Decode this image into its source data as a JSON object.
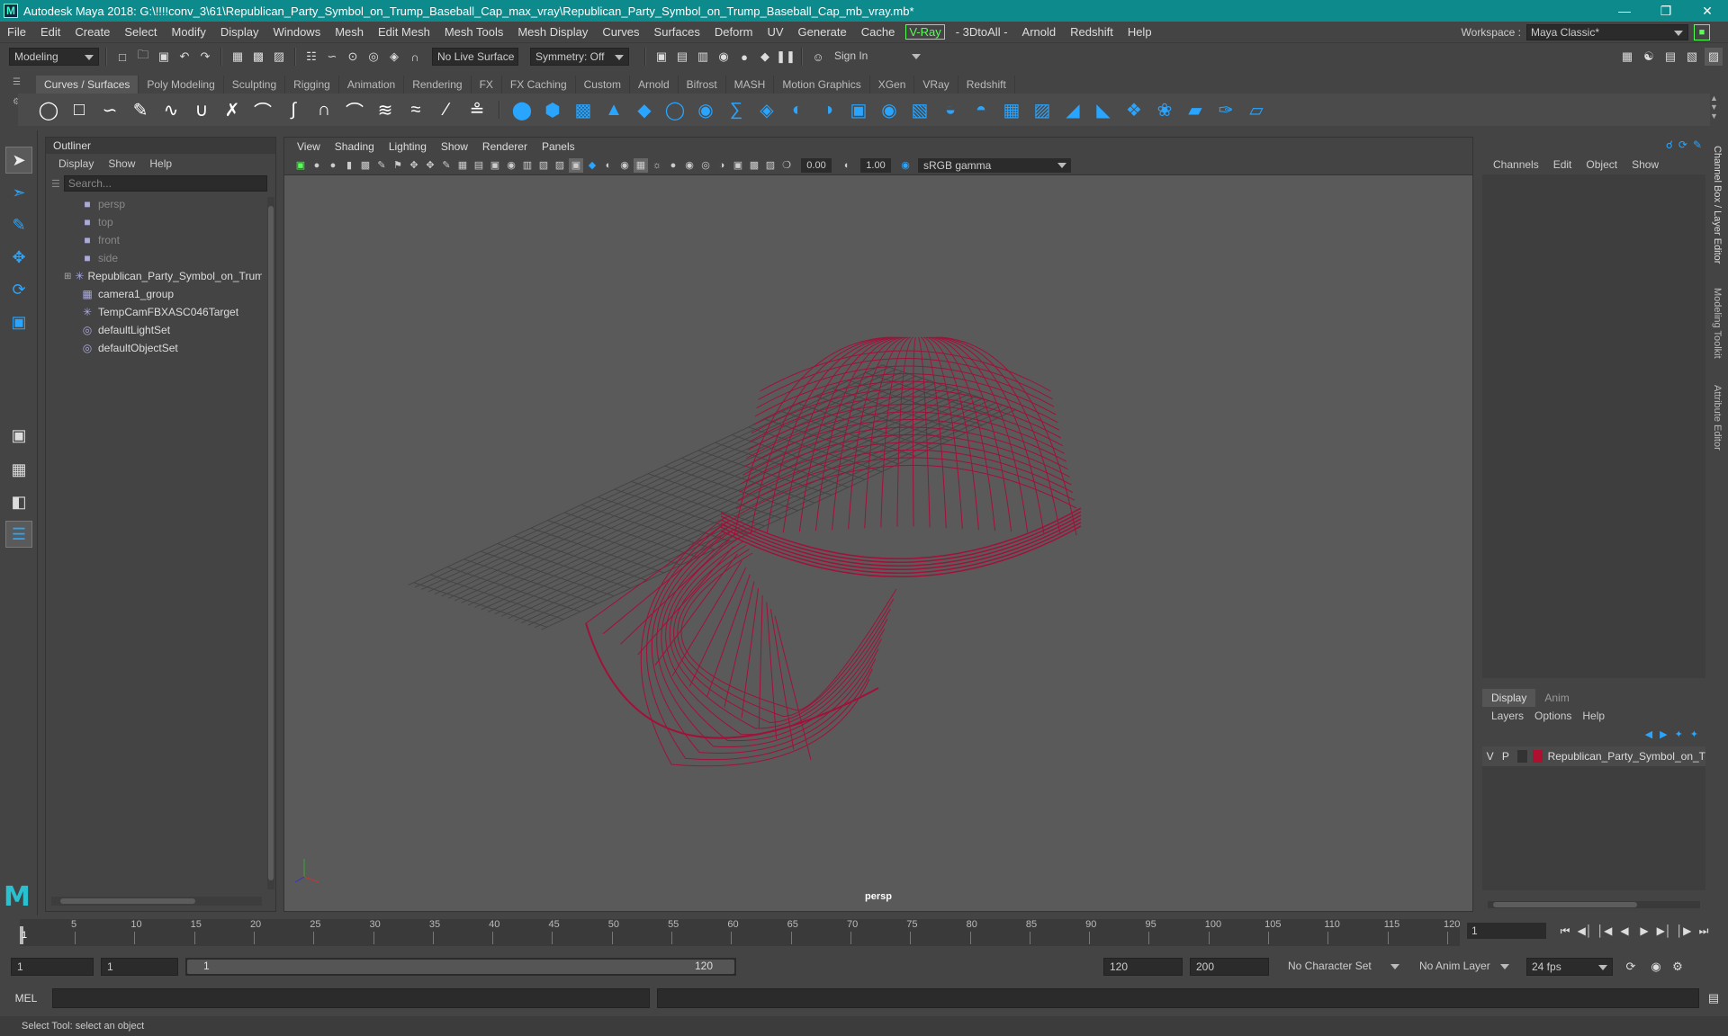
{
  "window": {
    "title": "Autodesk Maya 2018: G:\\!!!!conv_3\\61\\Republican_Party_Symbol_on_Trump_Baseball_Cap_max_vray\\Republican_Party_Symbol_on_Trump_Baseball_Cap_mb_vray.mb*",
    "logo": "M"
  },
  "menubar": {
    "items": [
      "File",
      "Edit",
      "Create",
      "Select",
      "Modify",
      "Display",
      "Windows",
      "Mesh",
      "Edit Mesh",
      "Mesh Tools",
      "Mesh Display",
      "Curves",
      "Surfaces",
      "Deform",
      "UV",
      "Generate",
      "Cache",
      "V-Ray",
      "- 3DtoAll -",
      "Arnold",
      "Redshift",
      "Help"
    ],
    "workspace_label": "Workspace :",
    "workspace_value": "Maya Classic*"
  },
  "statusline": {
    "mode": "Modeling",
    "live_surface": "No Live Surface",
    "symmetry": "Symmetry: Off",
    "sign_in": "Sign In"
  },
  "shelf": {
    "tabs": [
      "Curves / Surfaces",
      "Poly Modeling",
      "Sculpting",
      "Rigging",
      "Animation",
      "Rendering",
      "FX",
      "FX Caching",
      "Custom",
      "Arnold",
      "Bifrost",
      "MASH",
      "Motion Graphics",
      "XGen",
      "VRay",
      "Redshift"
    ],
    "active_tab": "Curves / Surfaces"
  },
  "outliner": {
    "title": "Outliner",
    "menu": [
      "Display",
      "Show",
      "Help"
    ],
    "search_placeholder": "Search...",
    "items": [
      {
        "label": "persp",
        "icon": "camera-icon",
        "dim": true,
        "expandable": false
      },
      {
        "label": "top",
        "icon": "camera-icon",
        "dim": true,
        "expandable": false
      },
      {
        "label": "front",
        "icon": "camera-icon",
        "dim": true,
        "expandable": false
      },
      {
        "label": "side",
        "icon": "camera-icon",
        "dim": true,
        "expandable": false
      },
      {
        "label": "Republican_Party_Symbol_on_Trump_",
        "icon": "transform-icon",
        "dim": false,
        "expandable": true
      },
      {
        "label": "camera1_group",
        "icon": "group-icon",
        "dim": false,
        "expandable": false
      },
      {
        "label": "TempCamFBXASC046Target",
        "icon": "transform-icon",
        "dim": false,
        "expandable": false
      },
      {
        "label": "defaultLightSet",
        "icon": "set-icon",
        "dim": false,
        "expandable": false
      },
      {
        "label": "defaultObjectSet",
        "icon": "set-icon",
        "dim": false,
        "expandable": false
      }
    ]
  },
  "viewport": {
    "menu": [
      "View",
      "Shading",
      "Lighting",
      "Show",
      "Renderer",
      "Panels"
    ],
    "exposure": "0.00",
    "gamma": "1.00",
    "color_space": "sRGB gamma",
    "camera_label": "persp",
    "wire_color": "#a3103a"
  },
  "channelbox": {
    "menu": [
      "Channels",
      "Edit",
      "Object",
      "Show"
    ],
    "side_tabs": [
      "Channel Box / Layer Editor",
      "Modeling Toolkit",
      "Attribute Editor"
    ]
  },
  "layers": {
    "tabs": [
      "Display",
      "Anim"
    ],
    "active_tab": "Display",
    "menu": [
      "Layers",
      "Options",
      "Help"
    ],
    "rows": [
      {
        "v": "V",
        "p": "P",
        "name": "Republican_Party_Symbol_on_T",
        "color": "#b01030"
      }
    ]
  },
  "timeline": {
    "ticks": [
      5,
      10,
      15,
      20,
      25,
      30,
      35,
      40,
      45,
      50,
      55,
      60,
      65,
      70,
      75,
      80,
      85,
      90,
      95,
      100,
      105,
      110,
      115,
      120
    ],
    "current_marker": "1",
    "current_frame": "1"
  },
  "range": {
    "start": "1",
    "playback_start": "1",
    "slider_start": "1",
    "slider_end": "120",
    "playback_end": "120",
    "end": "200",
    "character_set": "No Character Set",
    "anim_layer": "No Anim Layer",
    "fps": "24 fps"
  },
  "command": {
    "label": "MEL"
  },
  "helpline": {
    "text": "Select Tool: select an object"
  }
}
